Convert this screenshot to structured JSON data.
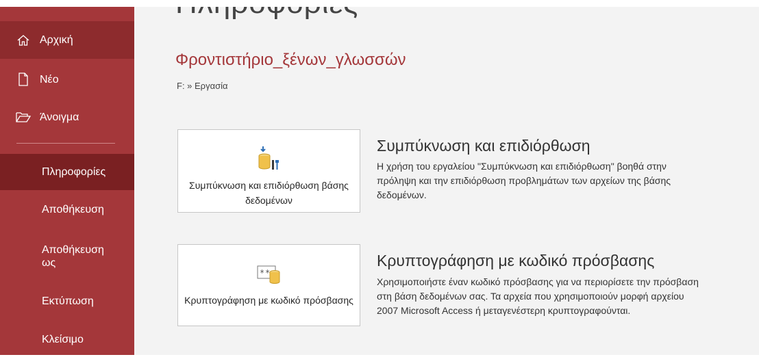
{
  "sidebar": {
    "items": [
      {
        "label": "Αρχική",
        "icon": "home-icon"
      },
      {
        "label": "Νέο",
        "icon": "new-document-icon"
      },
      {
        "label": "Άνοιγμα",
        "icon": "open-folder-icon"
      },
      {
        "label": "Πληροφορίες"
      },
      {
        "label": "Αποθήκευση"
      },
      {
        "label": "Αποθήκευση ως"
      },
      {
        "label": "Εκτύπωση"
      },
      {
        "label": "Κλείσιμο"
      }
    ],
    "active": "Πληροφορίες"
  },
  "main": {
    "title": "Πληροφορίες",
    "db_name": "Φροντιστήριο_ξένων_γλωσσών",
    "db_path": "F: » Εργασία",
    "sections": [
      {
        "button_label": "Συμπύκνωση και επιδιόρθωση βάσης δεδομένων",
        "icon": "compact-repair-database-icon",
        "heading": "Συμπύκνωση και επιδιόρθωση",
        "description": "Η χρήση του εργαλείου \"Συμπύκνωση και επιδιόρθωση\" βοηθά στην πρόληψη και την επιδιόρθωση προβλημάτων των αρχείων της βάσης δεδομένων."
      },
      {
        "button_label": "Κρυπτογράφηση με κωδικό πρόσβασης",
        "icon": "encrypt-password-icon",
        "heading": "Κρυπτογράφηση με κωδικό πρόσβασης",
        "description": "Χρησιμοποιήστε έναν κωδικό πρόσβασης για να περιορίσετε την πρόσβαση στη βάση δεδομένων σας. Τα αρχεία που χρησιμοποιούν μορφή αρχείου 2007 Microsoft Access ή μεταγενέστερη κρυπτογραφούνται."
      }
    ]
  },
  "colors": {
    "sidebar": "#a4373a",
    "sidebar_active": "#7a2022",
    "accent_text": "#a4373a",
    "main_bg": "#f3f3f3"
  }
}
